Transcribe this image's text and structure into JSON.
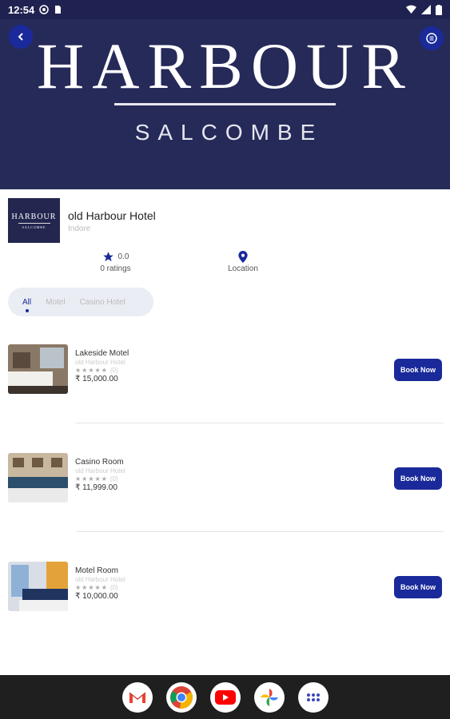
{
  "status_bar": {
    "time": "12:54"
  },
  "hero": {
    "brand": "HARBOUR",
    "subtitle": "SALCOMBE"
  },
  "hotel": {
    "logo_text": "HARBOUR",
    "logo_subtext": "SALCOMBE",
    "name": "old Harbour Hotel",
    "city": "Indore",
    "rating_value": "0.0",
    "ratings_label": "0 ratings",
    "location_label": "Location"
  },
  "tabs": [
    {
      "label": "All",
      "active": true
    },
    {
      "label": "Motel",
      "active": false
    },
    {
      "label": "Casino Hotel",
      "active": false
    }
  ],
  "rooms": [
    {
      "title": "Lakeside Motel",
      "hotel": "old Harbour Hotel",
      "stars": "★★★★★",
      "reviews": "(0)",
      "price": "₹ 15,000.00",
      "book_label": "Book Now"
    },
    {
      "title": "Casino Room",
      "hotel": "old Harbour Hotel",
      "stars": "★★★★★",
      "reviews": "(0)",
      "price": "₹ 11,999.00",
      "book_label": "Book Now"
    },
    {
      "title": "Motel Room",
      "hotel": "old Harbour Hotel",
      "stars": "★★★★★",
      "reviews": "(0)",
      "price": "₹ 10,000.00",
      "book_label": "Book Now"
    }
  ],
  "dock": [
    "gmail-icon",
    "chrome-icon",
    "youtube-icon",
    "photos-icon",
    "app-drawer-icon"
  ],
  "colors": {
    "primary": "#1a2a9a",
    "hero_bg": "#262a59"
  }
}
